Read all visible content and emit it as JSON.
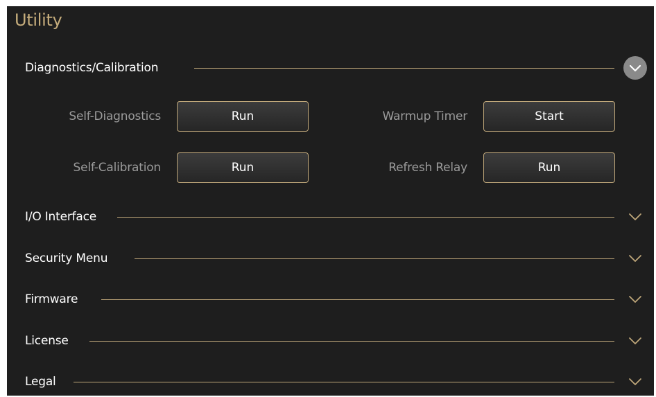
{
  "page": {
    "title": "Utility"
  },
  "sections": {
    "diagnostics": {
      "label": "Diagnostics/Calibration",
      "expanded": true,
      "icon": "chevron-up-circle-icon",
      "controls": {
        "self_diagnostics": {
          "label": "Self-Diagnostics",
          "button": "Run"
        },
        "warmup_timer": {
          "label": "Warmup Timer",
          "button": "Start"
        },
        "self_calibration": {
          "label": "Self-Calibration",
          "button": "Run"
        },
        "refresh_relay": {
          "label": "Refresh Relay",
          "button": "Run"
        }
      }
    },
    "io_interface": {
      "label": "I/O Interface",
      "expanded": false,
      "icon": "chevron-down-icon"
    },
    "security_menu": {
      "label": "Security Menu",
      "expanded": false,
      "icon": "chevron-down-icon"
    },
    "firmware": {
      "label": "Firmware",
      "expanded": false,
      "icon": "chevron-down-icon"
    },
    "license": {
      "label": "License",
      "expanded": false,
      "icon": "chevron-down-icon"
    },
    "legal": {
      "label": "Legal",
      "expanded": false,
      "icon": "chevron-down-icon"
    }
  },
  "colors": {
    "background": "#1e1e1e",
    "accent": "#bfa77a",
    "title": "#c6ad7c",
    "section_text": "#ffffff",
    "field_label_text": "#9b9b9b",
    "button_text": "#ffffff"
  }
}
